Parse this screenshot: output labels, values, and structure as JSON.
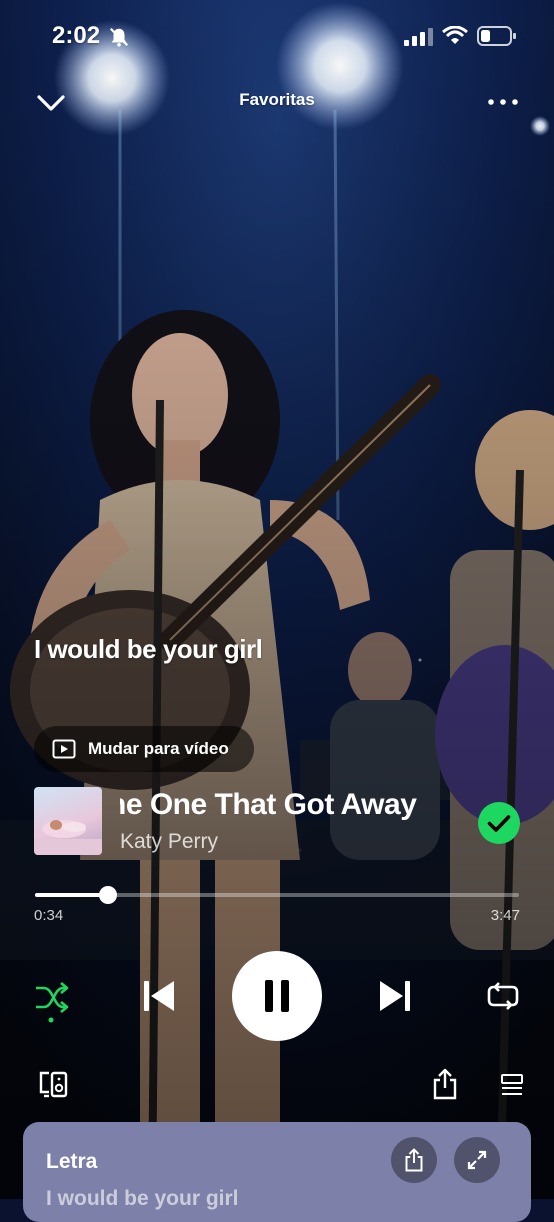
{
  "status_bar": {
    "time": "2:02"
  },
  "header": {
    "title": "Favoritas"
  },
  "lyrics": {
    "current_line": "I would be your girl"
  },
  "video_toggle": {
    "label": "Mudar para vídeo"
  },
  "track": {
    "title": "he One That Got Away",
    "artist": "Katy Perry"
  },
  "progress": {
    "elapsed": "0:34",
    "duration": "3:47",
    "fraction": 0.15
  },
  "lyrics_card": {
    "label": "Letra",
    "peek_line": "I would be your girl"
  },
  "colors": {
    "accent": "#1ed760",
    "card_bg": "#7d80a8"
  },
  "icons": [
    "bell-slash-icon",
    "signal-icon",
    "wifi-icon",
    "battery-icon",
    "chevron-down-icon",
    "more-icon",
    "play-square-icon",
    "check-circle-icon",
    "shuffle-icon",
    "previous-icon",
    "pause-icon",
    "next-icon",
    "repeat-icon",
    "devices-icon",
    "share-icon",
    "queue-icon",
    "expand-icon"
  ]
}
